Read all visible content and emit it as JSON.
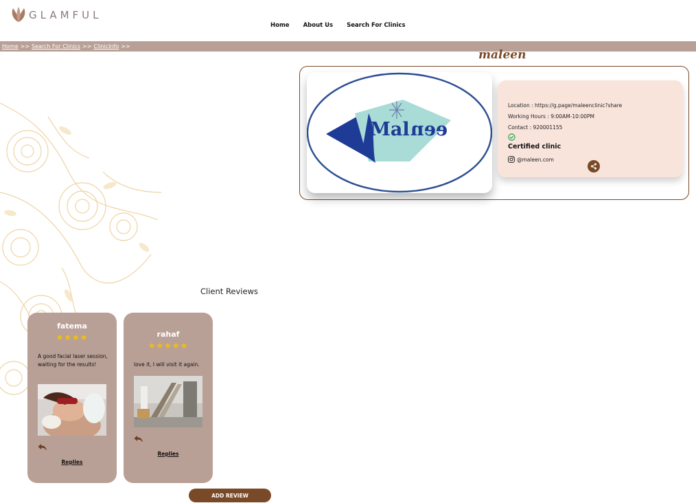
{
  "header": {
    "logo_text": "GLAMFUL",
    "nav": [
      "Home",
      "About Us",
      "Search For Clinics"
    ]
  },
  "breadcrumb": {
    "items": [
      "Home",
      "Search For Clinics",
      "ClinicInfo"
    ],
    "separator": ">>"
  },
  "clinic": {
    "name": "maleen",
    "logo_text_a": "Mal",
    "logo_text_b": "een",
    "location": "Location : https://g.page/maleenclinic?share",
    "hours": "Working Hours : 9:00AM-10:00PM",
    "contact": "Contact : 920001155",
    "certified": "Certified clinic",
    "instagram": "@maleen.com"
  },
  "reviews": {
    "title": "Client Reviews",
    "items": [
      {
        "name": "fatema",
        "rating": 4,
        "text": "A good facial laser session, waiting for the results!",
        "replies_label": "Replies"
      },
      {
        "name": "rahaf",
        "rating": 5,
        "text": "love it, I will visit it again.",
        "replies_label": "Replies"
      }
    ],
    "add_review_label": "ADD REVIEW"
  },
  "colors": {
    "brand_brown": "#7a4a28",
    "breadcrumb_bg": "#b9a096",
    "info_bg": "#f9e4dc",
    "star": "#f2c200"
  },
  "icons": [
    "leaf-logo-icon",
    "check-circle-icon",
    "instagram-icon",
    "share-icon",
    "reply-icon"
  ]
}
